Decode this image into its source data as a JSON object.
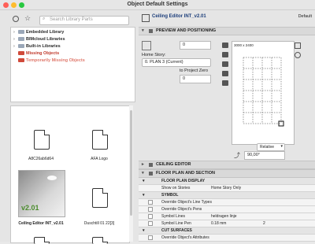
{
  "window": {
    "title": "Object Default Settings"
  },
  "left": {
    "search_placeholder": "Search Library Parts",
    "tree": [
      {
        "label": "Embedded Library",
        "color": "#9aa7b8",
        "text_color": "#2a2a2a"
      },
      {
        "label": "BIMcloud Libraries",
        "color": "#9aa7b8",
        "text_color": "#2a2a2a"
      },
      {
        "label": "Built-in Libraries",
        "color": "#9aa7b8",
        "text_color": "#2a2a2a"
      },
      {
        "label": "Missing Objects",
        "color": "#d04a3a",
        "text_color": "#c0392b"
      },
      {
        "label": "Temporarily Missing Objects",
        "color": "#d04a3a",
        "text_color": "#e07b6e"
      }
    ],
    "tiles": [
      {
        "label": "A8C26ab6d64"
      },
      {
        "label": "AFA Logo"
      },
      {
        "label": "Ceiling Editor INT_v2.01",
        "badge": "v2.01"
      },
      {
        "label": "Duschtill 01 22[3]"
      }
    ]
  },
  "right": {
    "header_title": "Ceiling Editor INT_v2.01",
    "header_default": "Default",
    "sections": {
      "preview": "PREVIEW AND POSITIONING",
      "ceiling": "CEILING EDITOR",
      "floor_plan": "FLOOR PLAN AND SECTION"
    },
    "fields": {
      "top_value": "0",
      "home_story_label": "Home Story:",
      "home_story_value": "0. PLAN 3 (Current)",
      "to_project_zero": "to Project Zero",
      "zero_value": "0",
      "grid_label": "3000 x 2400",
      "relative": "Relative",
      "angle": "90,00°"
    },
    "rows": [
      {
        "name": "FLOOR PLAN DISPLAY",
        "value": "",
        "bold": true
      },
      {
        "name": "Show on Stories",
        "value": "Home Story Only",
        "bold": false
      },
      {
        "name": "SYMBOL",
        "value": "",
        "bold": true
      },
      {
        "name": "Override Object's Line Types",
        "value": "",
        "bold": false
      },
      {
        "name": "Override Object's Pens",
        "value": "",
        "bold": false
      },
      {
        "name": "Symbol Lines",
        "value": "heldragen linje",
        "bold": false
      },
      {
        "name": "Symbol Line Pen",
        "value": "0.18 mm",
        "extra": "2",
        "bold": false
      },
      {
        "name": "CUT SURFACES",
        "value": "",
        "bold": true
      },
      {
        "name": "Override Object's Attributes",
        "value": "",
        "bold": false
      }
    ]
  }
}
